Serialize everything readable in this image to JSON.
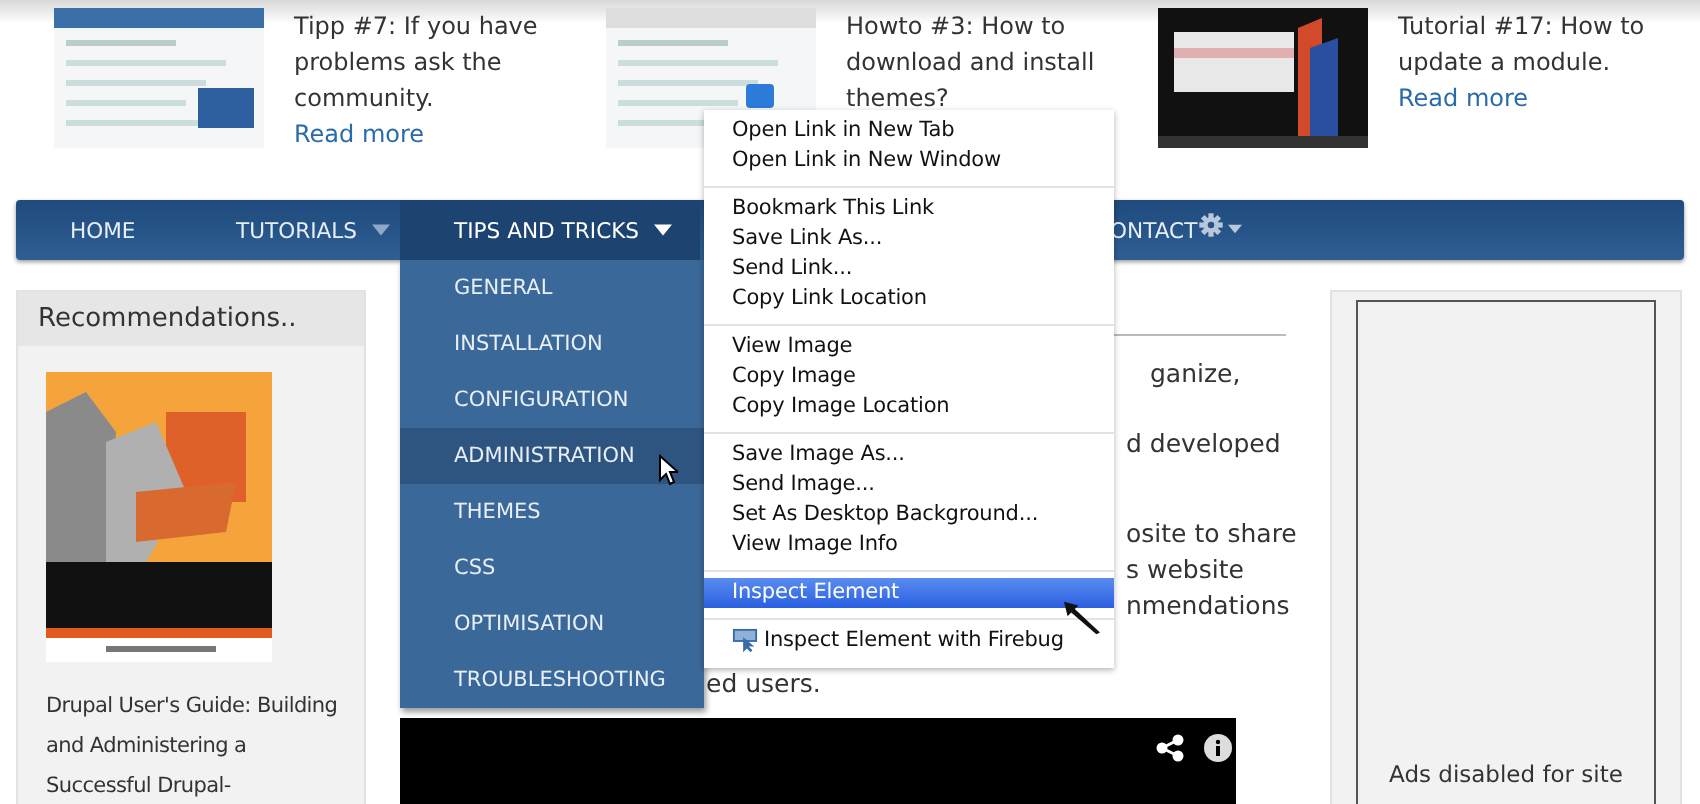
{
  "teasers": [
    {
      "title": "Tipp #7: If you have problems ask the community.",
      "link": "Read more"
    },
    {
      "title": "Howto #3: How to download and install themes?"
    },
    {
      "title": "Tutorial #17: How to update a module.",
      "link": "Read more"
    }
  ],
  "nav": {
    "items": [
      {
        "label": "HOME",
        "selected": false,
        "has_caret": false
      },
      {
        "label": "TUTORIALS",
        "selected": false,
        "has_caret": true
      },
      {
        "label": "TIPS AND TRICKS",
        "selected": true,
        "has_caret": true
      },
      {
        "label": "ONTACT",
        "selected": false,
        "has_caret": false
      }
    ]
  },
  "dropdown": {
    "items": [
      {
        "label": "GENERAL",
        "selected": false
      },
      {
        "label": "INSTALLATION",
        "selected": false
      },
      {
        "label": "CONFIGURATION",
        "selected": false
      },
      {
        "label": "ADMINISTRATION",
        "selected": true
      },
      {
        "label": "THEMES",
        "selected": false
      },
      {
        "label": "CSS",
        "selected": false
      },
      {
        "label": "OPTIMISATION",
        "selected": false
      },
      {
        "label": "TROUBLESHOOTING",
        "selected": false
      }
    ]
  },
  "context_menu": {
    "groups": [
      [
        {
          "label": "Open Link in New Tab",
          "selected": false,
          "kind": "plain"
        },
        {
          "label": "Open Link in New Window",
          "selected": false,
          "kind": "plain"
        }
      ],
      [
        {
          "label": "Bookmark This Link",
          "selected": false,
          "kind": "plain"
        },
        {
          "label": "Save Link As...",
          "selected": false,
          "kind": "plain"
        },
        {
          "label": "Send Link...",
          "selected": false,
          "kind": "plain"
        },
        {
          "label": "Copy Link Location",
          "selected": false,
          "kind": "plain"
        }
      ],
      [
        {
          "label": "View Image",
          "selected": false,
          "kind": "plain"
        },
        {
          "label": "Copy Image",
          "selected": false,
          "kind": "plain"
        },
        {
          "label": "Copy Image Location",
          "selected": false,
          "kind": "plain"
        }
      ],
      [
        {
          "label": "Save Image As...",
          "selected": false,
          "kind": "plain"
        },
        {
          "label": "Send Image...",
          "selected": false,
          "kind": "plain"
        },
        {
          "label": "Set As Desktop Background...",
          "selected": false,
          "kind": "plain"
        },
        {
          "label": "View Image Info",
          "selected": false,
          "kind": "plain"
        }
      ],
      [
        {
          "label": "Inspect Element",
          "selected": true,
          "kind": "plain"
        }
      ],
      [
        {
          "label": "Inspect Element with Firebug",
          "selected": false,
          "kind": "with_icon"
        }
      ]
    ]
  },
  "sidebar": {
    "title": "Recommendations..",
    "book_title": "Drupal User's Guide: Building and Administering a Successful Drupal-"
  },
  "content": {
    "fragments": [
      "ganize,",
      "d developed",
      "osite to share",
      "s website",
      "nmendations"
    ],
    "last_line": "ed users."
  },
  "ads": {
    "text": "Ads disabled for site"
  }
}
